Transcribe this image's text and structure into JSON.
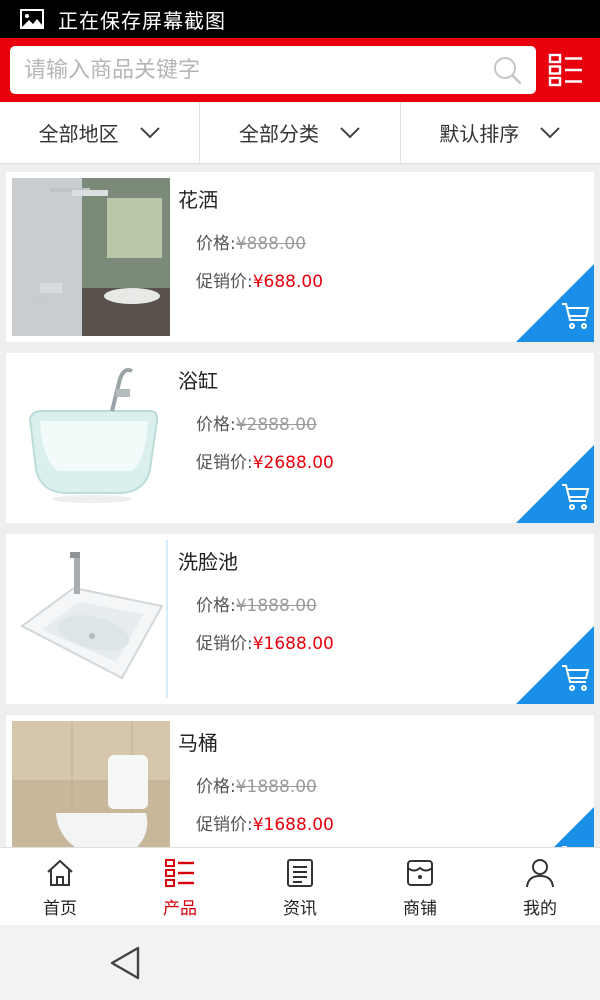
{
  "status_bar": {
    "text": "正在保存屏幕截图",
    "icon": "screenshot-icon"
  },
  "search": {
    "placeholder": "请输入商品关键字",
    "value": ""
  },
  "filters": [
    {
      "label": "全部地区"
    },
    {
      "label": "全部分类"
    },
    {
      "label": "默认排序"
    }
  ],
  "products": [
    {
      "name": "花洒",
      "price_label": "价格:",
      "price": "¥888.00",
      "promo_label": "促销价:",
      "promo_price": "¥688.00"
    },
    {
      "name": "浴缸",
      "price_label": "价格:",
      "price": "¥2888.00",
      "promo_label": "促销价:",
      "promo_price": "¥2688.00"
    },
    {
      "name": "洗脸池",
      "price_label": "价格:",
      "price": "¥1888.00",
      "promo_label": "促销价:",
      "promo_price": "¥1688.00"
    },
    {
      "name": "马桶",
      "price_label": "价格:",
      "price": "¥1888.00",
      "promo_label": "促销价:",
      "promo_price": "¥1688.00"
    }
  ],
  "nav": [
    {
      "label": "首页",
      "icon": "home-icon"
    },
    {
      "label": "产品",
      "icon": "list-icon",
      "active": true
    },
    {
      "label": "资讯",
      "icon": "news-icon"
    },
    {
      "label": "商铺",
      "icon": "shop-icon"
    },
    {
      "label": "我的",
      "icon": "user-icon"
    }
  ],
  "colors": {
    "brand_red": "#e8000d",
    "cart_blue": "#1a8fe8",
    "promo_red": "#e8000d"
  }
}
